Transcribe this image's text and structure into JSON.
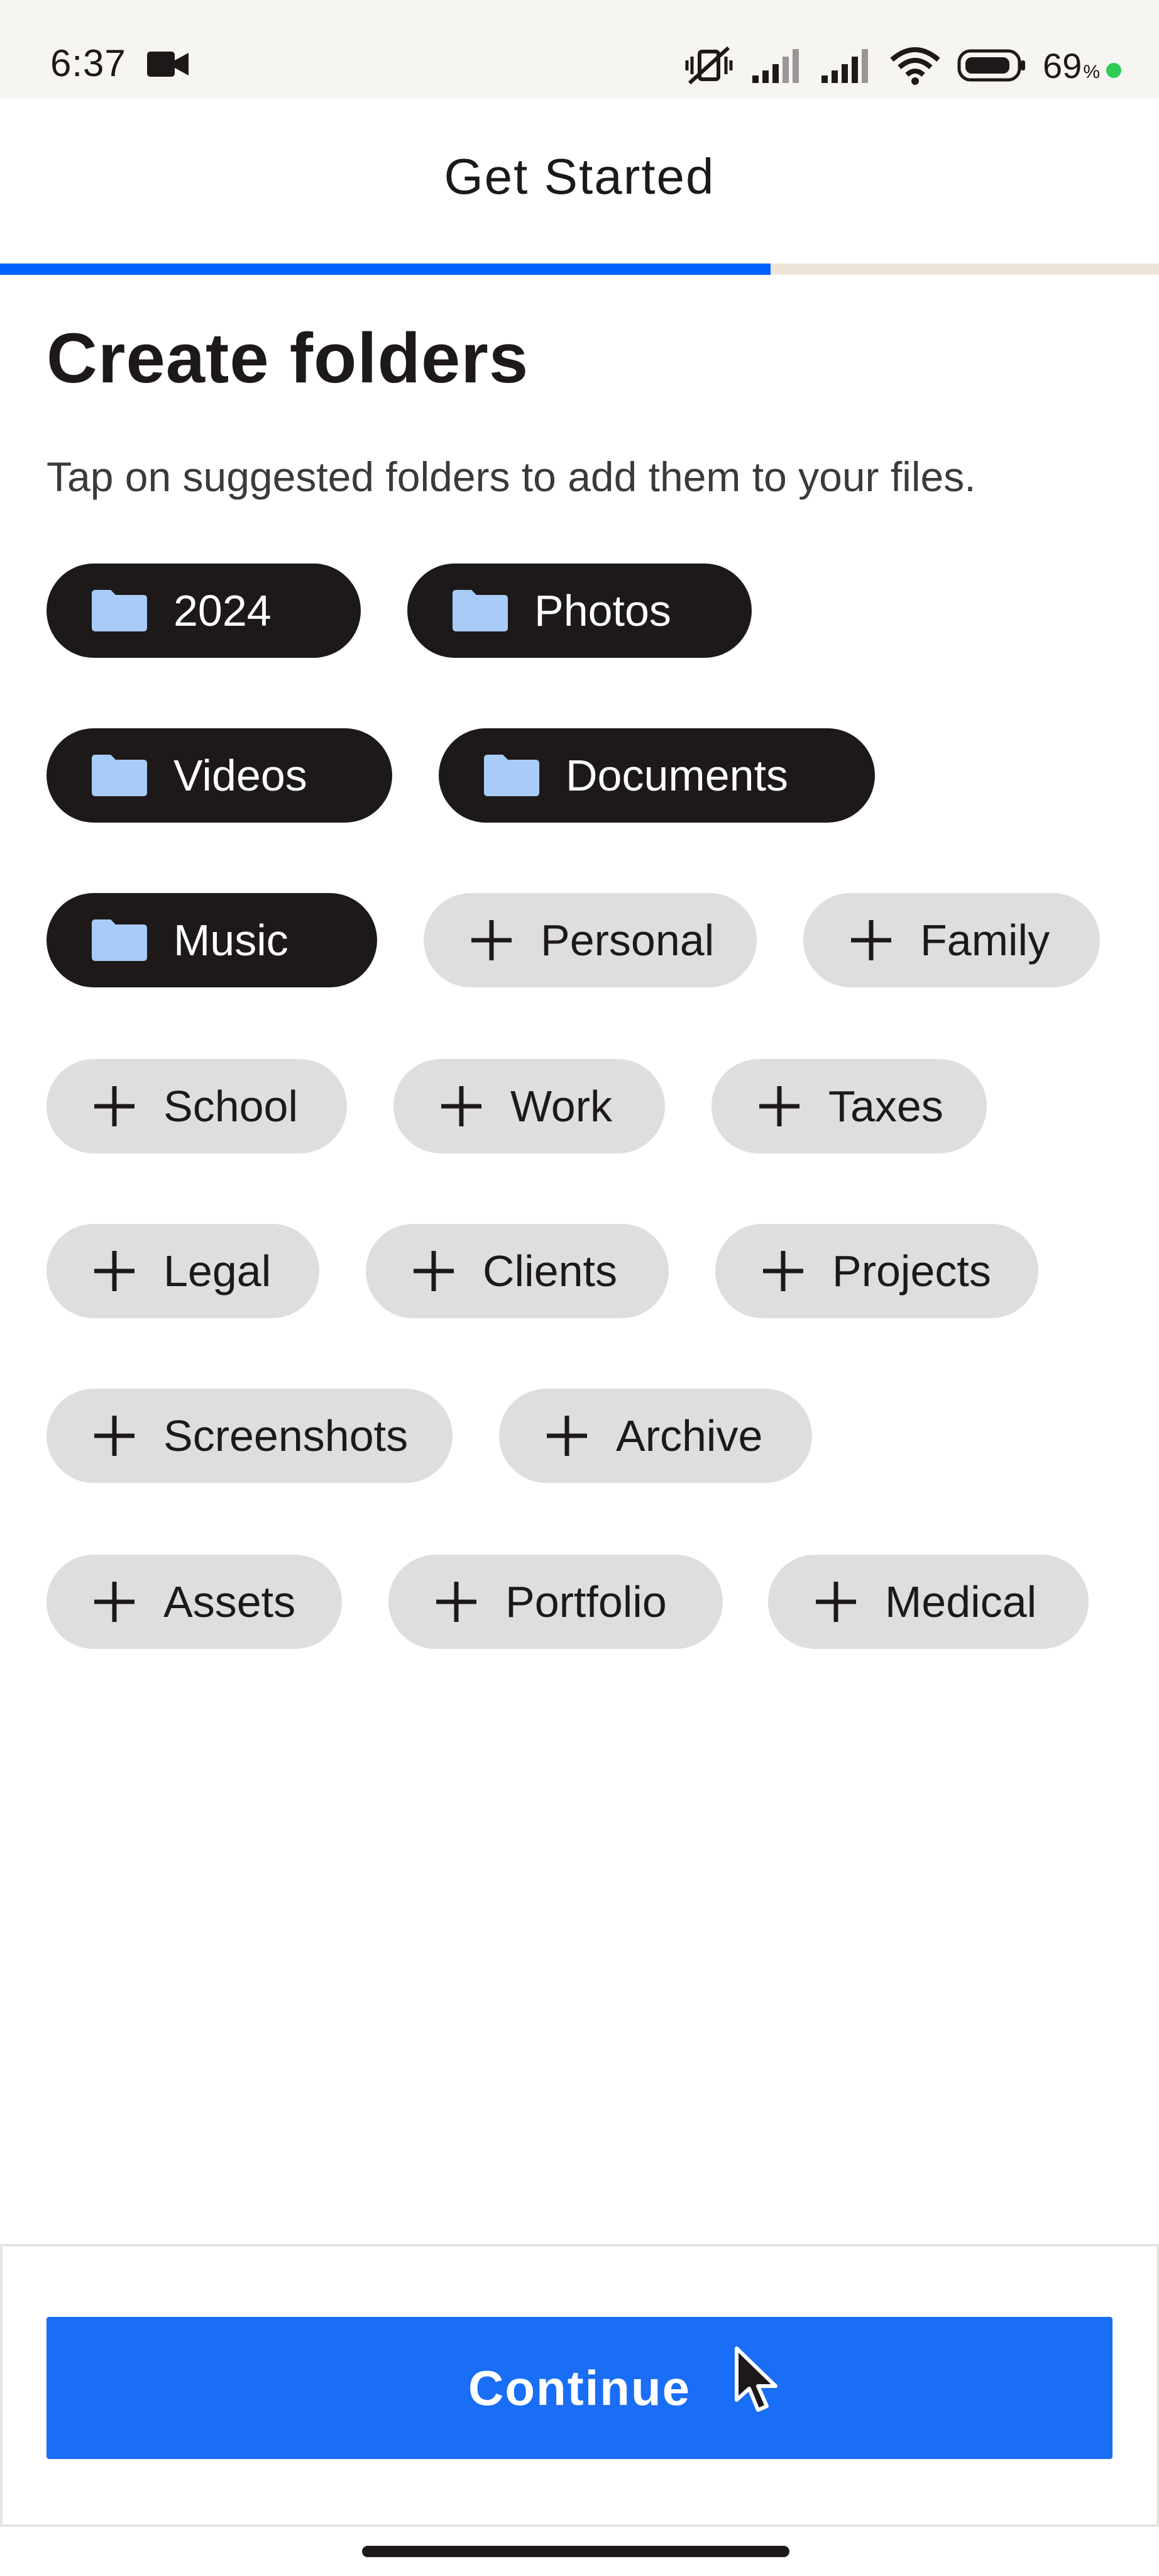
{
  "status_bar": {
    "time": "6:37",
    "battery_percent": "69",
    "battery_unit": "%",
    "icons": [
      "video-camera-icon",
      "vibrate-mute-icon",
      "signal-icon",
      "signal-icon",
      "wifi-icon",
      "battery-icon",
      "charging-dot-icon"
    ],
    "charge_color": "#2ecc52"
  },
  "header": {
    "title": "Get Started",
    "progress_fraction": 0.665,
    "progress_color": "#0061fe",
    "track_color": "#ede5d8"
  },
  "main": {
    "title": "Create folders",
    "subtitle": "Tap on suggested folders to add them to your files.",
    "chips": [
      {
        "label": "2024",
        "selected": true,
        "icon": "folder-icon"
      },
      {
        "label": "Photos",
        "selected": true,
        "icon": "folder-icon"
      },
      {
        "label": "Videos",
        "selected": true,
        "icon": "folder-icon"
      },
      {
        "label": "Documents",
        "selected": true,
        "icon": "folder-icon"
      },
      {
        "label": "Music",
        "selected": true,
        "icon": "folder-icon"
      },
      {
        "label": "Personal",
        "selected": false,
        "icon": "plus-icon"
      },
      {
        "label": "Family",
        "selected": false,
        "icon": "plus-icon"
      },
      {
        "label": "School",
        "selected": false,
        "icon": "plus-icon"
      },
      {
        "label": "Work",
        "selected": false,
        "icon": "plus-icon"
      },
      {
        "label": "Taxes",
        "selected": false,
        "icon": "plus-icon"
      },
      {
        "label": "Legal",
        "selected": false,
        "icon": "plus-icon"
      },
      {
        "label": "Clients",
        "selected": false,
        "icon": "plus-icon"
      },
      {
        "label": "Projects",
        "selected": false,
        "icon": "plus-icon"
      },
      {
        "label": "Screenshots",
        "selected": false,
        "icon": "plus-icon"
      },
      {
        "label": "Archive",
        "selected": false,
        "icon": "plus-icon"
      },
      {
        "label": "Assets",
        "selected": false,
        "icon": "plus-icon"
      },
      {
        "label": "Portfolio",
        "selected": false,
        "icon": "plus-icon"
      },
      {
        "label": "Medical",
        "selected": false,
        "icon": "plus-icon"
      }
    ],
    "selected_chip_color": "#1e1919",
    "unselected_chip_color": "#dedede",
    "folder_icon_color": "#a8ccf7"
  },
  "footer": {
    "continue_label": "Continue",
    "button_color": "#1a6ef5"
  }
}
